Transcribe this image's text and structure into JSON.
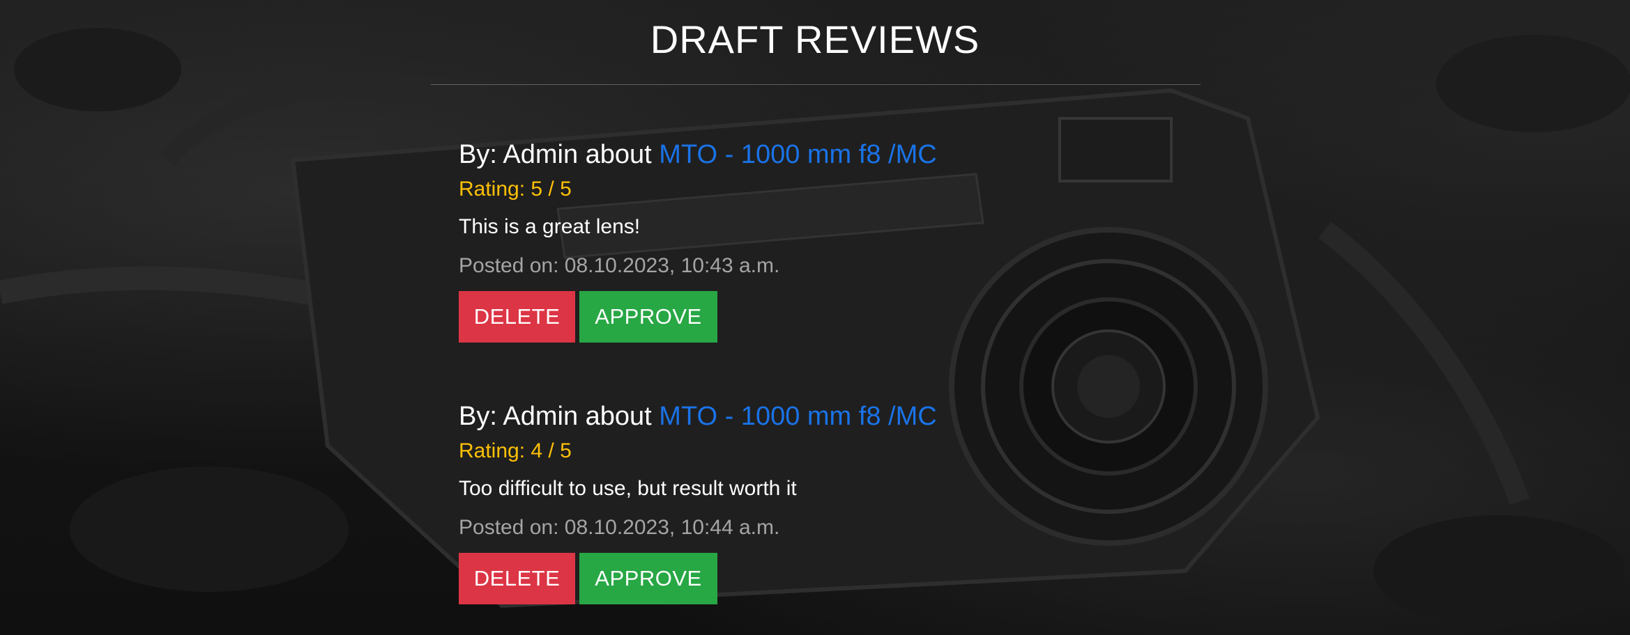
{
  "page": {
    "title": "DRAFT REVIEWS"
  },
  "colors": {
    "link": "#1a73e8",
    "rating": "#ffc107",
    "muted": "#a5a5a5",
    "delete": "#dc3545",
    "approve": "#28a745"
  },
  "background": {
    "description_icon": "camera-photo-background"
  },
  "reviews": [
    {
      "by_prefix": "By: Admin about ",
      "product": "MTO - 1000 mm f8 /MC",
      "rating": "Rating: 5 / 5",
      "text": "This is a great lens!",
      "posted": "Posted on: 08.10.2023, 10:43 a.m.",
      "delete_label": "DELETE",
      "approve_label": "APPROVE"
    },
    {
      "by_prefix": "By: Admin about ",
      "product": "MTO - 1000 mm f8 /MC",
      "rating": "Rating: 4 / 5",
      "text": "Too difficult to use, but result worth it",
      "posted": "Posted on: 08.10.2023, 10:44 a.m.",
      "delete_label": "DELETE",
      "approve_label": "APPROVE"
    }
  ]
}
